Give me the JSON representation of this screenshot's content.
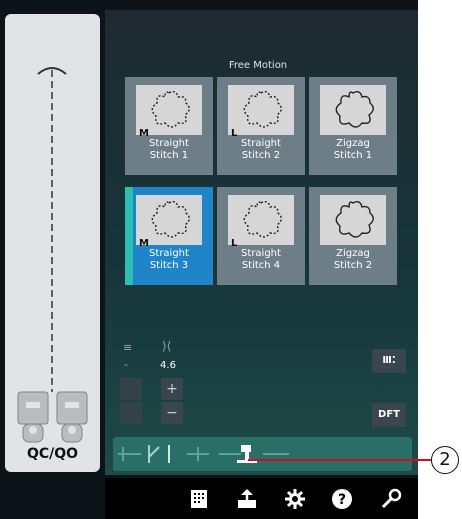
{
  "side_panel": {
    "label": "QC/QO"
  },
  "free_motion": {
    "title": "Free Motion",
    "stitches": [
      {
        "name_line1": "Straight",
        "name_line2": "Stitch 1",
        "foot": "M",
        "shape": "dashed"
      },
      {
        "name_line1": "Straight",
        "name_line2": "Stitch 2",
        "foot": "L",
        "shape": "dashed"
      },
      {
        "name_line1": "Zigzag",
        "name_line2": "Stitch 1",
        "foot": "",
        "shape": "solid"
      },
      {
        "name_line1": "Straight",
        "name_line2": "Stitch 3",
        "foot": "M",
        "shape": "dashed",
        "selected": true
      },
      {
        "name_line1": "Straight",
        "name_line2": "Stitch 4",
        "foot": "L",
        "shape": "dashed"
      },
      {
        "name_line1": "Zigzag",
        "name_line2": "Stitch 2",
        "foot": "",
        "shape": "solid"
      }
    ]
  },
  "controls": {
    "minus_dim": "-",
    "width_value": "4.6",
    "plus_label": "+",
    "minus_label": "−"
  },
  "right_buttons": {
    "dft_label": "DFT"
  },
  "callout": {
    "number": "2"
  },
  "colors": {
    "selected": "#1f84c8",
    "accent": "#2bbfb3",
    "tile": "#6e7e88",
    "toolbar": "#2a6e68",
    "callout_line": "#d01020"
  },
  "icons": [
    "stitch-length-icon",
    "stitch-width-icon",
    "thread-tension-icon",
    "toolbar-stitch-icon",
    "toolbar-needle-icon",
    "toolbar-foot-icon",
    "stitch-menu-icon",
    "export-icon",
    "settings-gear-icon",
    "help-icon",
    "tools-icon"
  ]
}
